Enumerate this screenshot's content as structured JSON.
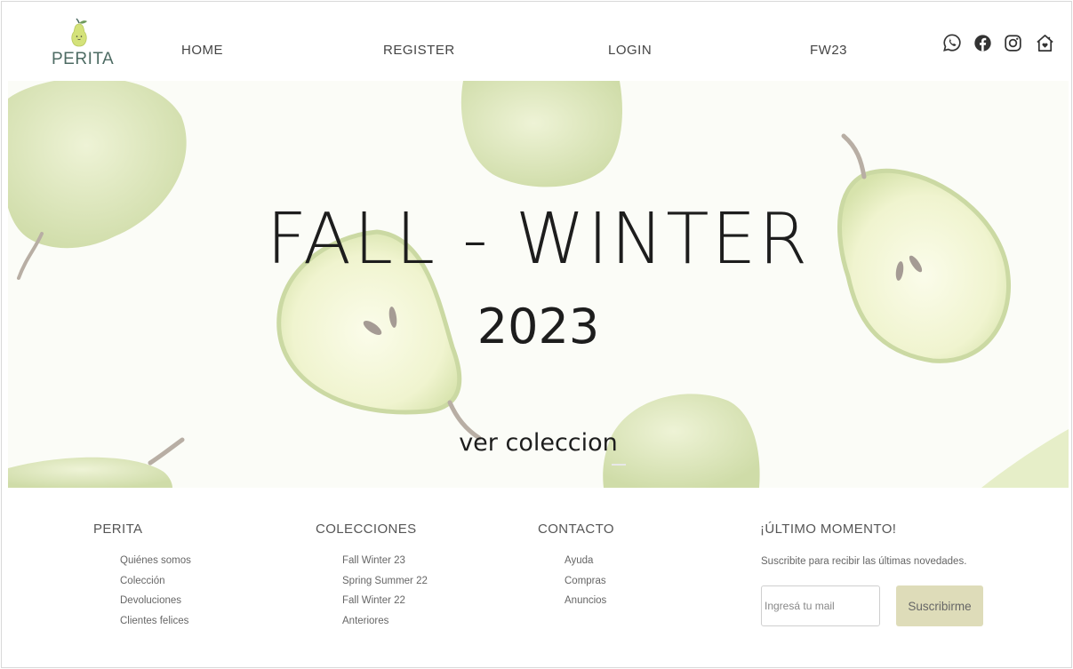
{
  "brand": {
    "name": "PERITA"
  },
  "nav": {
    "items": [
      {
        "label": "HOME"
      },
      {
        "label": "REGISTER"
      },
      {
        "label": "LOGIN"
      },
      {
        "label": "FW23"
      }
    ]
  },
  "social": [
    {
      "icon": "whatsapp-icon"
    },
    {
      "icon": "facebook-icon"
    },
    {
      "icon": "instagram-icon"
    },
    {
      "icon": "home-heart-icon"
    }
  ],
  "hero": {
    "title": "FALL - WINTER",
    "year": "2023",
    "cta": "ver coleccion"
  },
  "footer": {
    "columns": [
      {
        "title": "PERITA",
        "links": [
          "Quiénes somos",
          "Colección",
          "Devoluciones",
          "Clientes felices"
        ]
      },
      {
        "title": "COLECCIONES",
        "links": [
          "Fall Winter 23",
          "Spring Summer 22",
          "Fall Winter 22",
          "Anteriores"
        ]
      },
      {
        "title": "CONTACTO",
        "links": [
          "Ayuda",
          "Compras",
          "Anuncios"
        ]
      }
    ],
    "newsletter": {
      "title": "¡ÚLTIMO MOMENTO!",
      "text": "Suscribite para recibir las últimas novedades.",
      "placeholder": "Ingresá tu mail",
      "button": "Suscribirme"
    }
  },
  "colors": {
    "pear_light": "#e4ecc6",
    "pear_mid": "#cfddab",
    "pear_flesh": "#f3f6dc",
    "stem": "#a59b94",
    "button_bg": "#dedcb9",
    "logo_green": "#4d6b63"
  }
}
